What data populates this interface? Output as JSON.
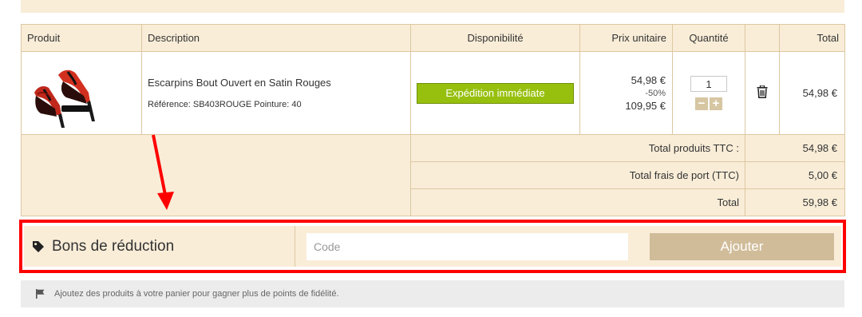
{
  "cart": {
    "columns": {
      "product": "Produit",
      "description": "Description",
      "availability": "Disponibilité",
      "unit_price": "Prix unitaire",
      "quantity": "Quantité",
      "total": "Total"
    },
    "item": {
      "name": "Escarpins Bout Ouvert en Satin Rouges",
      "reference": "Référence: SB403ROUGE Pointure: 40",
      "availability": "Expédition immédiate",
      "price_now": "54,98 €",
      "discount": "-50%",
      "price_old": "109,95 €",
      "quantity": "1",
      "total": "54,98 €"
    },
    "summary": [
      {
        "label": "Total produits TTC :",
        "value": "54,98 €"
      },
      {
        "label": "Total frais de port (TTC)",
        "value": "5,00 €"
      },
      {
        "label": "Total",
        "value": "59,98 €"
      }
    ]
  },
  "voucher": {
    "title": "Bons de réduction",
    "code_placeholder": "Code",
    "add_label": "Ajouter"
  },
  "fidelity": {
    "message": "Ajoutez des produits à votre panier pour gagner plus de points de fidélité."
  },
  "colors": {
    "beige": "#f9edd8",
    "border": "#dcc7a0",
    "green": "#97c00e",
    "add_button": "#d0bc99",
    "highlight": "#ff0000"
  },
  "icons": {
    "tag": "tag-icon",
    "trash": "trash-icon",
    "flag": "flag-icon",
    "arrow": "red-arrow-annotation"
  }
}
